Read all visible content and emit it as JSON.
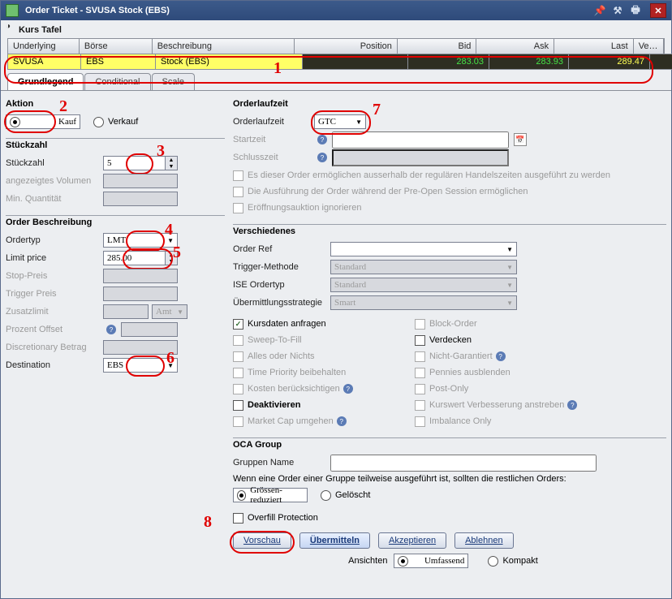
{
  "window": {
    "title": "Order Ticket - SVUSA Stock (EBS)"
  },
  "quote": {
    "panel_title": "Kurs Tafel",
    "headers": [
      "Underlying",
      "Börse",
      "Beschreibung",
      "Position",
      "Bid",
      "Ask",
      "Last",
      "Verla..."
    ],
    "row": {
      "underlying": "SVUSA",
      "exchange": "EBS",
      "description": "Stock (EBS)",
      "position": "",
      "bid": "283.03",
      "ask": "283.93",
      "last": "289.47"
    }
  },
  "tabs": [
    "Grundlegend",
    "Conditional",
    "Scale"
  ],
  "left": {
    "aktion": {
      "heading": "Aktion",
      "buy": "Kauf",
      "sell": "Verkauf"
    },
    "qty": {
      "heading": "Stückzahl",
      "label": "Stückzahl",
      "value": "5",
      "disp_vol": "angezeigtes Volumen",
      "min_qty": "Min. Quantität"
    },
    "desc": {
      "heading": "Order Beschreibung",
      "ordertyp_l": "Ordertyp",
      "ordertyp_v": "LMT",
      "limit_l": "Limit price",
      "limit_v": "285.00",
      "stop_l": "Stop-Preis",
      "trigger_l": "Trigger Preis",
      "zusatz_l": "Zusatzlimit",
      "zusatz_v": "Amt",
      "offset_l": "Prozent Offset",
      "discr_l": "Discretionary Betrag",
      "dest_l": "Destination",
      "dest_v": "EBS"
    }
  },
  "right": {
    "tif": {
      "heading": "Orderlaufzeit",
      "label": "Orderlaufzeit",
      "value": "GTC",
      "start_l": "Startzeit",
      "end_l": "Schlusszeit",
      "opt1": "Es dieser Order ermöglichen ausserhalb der regulären Handelszeiten ausgeführt zu werden",
      "opt2": "Die Ausführung der Order während der Pre-Open Session ermöglichen",
      "opt3": "Eröffnungsauktion ignorieren"
    },
    "misc": {
      "heading": "Verschiedenes",
      "ref_l": "Order Ref",
      "trig_l": "Trigger-Methode",
      "trig_v": "Standard",
      "ise_l": "ISE Ordertyp",
      "ise_v": "Standard",
      "ueb_l": "Übermittlungsstrategie",
      "ueb_v": "Smart",
      "c": {
        "kursdaten": "Kursdaten anfragen",
        "block": "Block-Order",
        "sweep": "Sweep-To-Fill",
        "verdecken": "Verdecken",
        "aon": "Alles oder Nichts",
        "ngar": "Nicht-Garantiert",
        "timeprio": "Time Priority beibehalten",
        "pennies": "Pennies ausblenden",
        "kosten": "Kosten berücksichtigen",
        "postonly": "Post-Only",
        "deakt": "Deaktivieren",
        "kurswert": "Kurswert Verbesserung anstreben",
        "marketcap": "Market Cap umgehen",
        "imbalance": "Imbalance Only"
      }
    },
    "oca": {
      "heading": "OCA Group",
      "group_l": "Gruppen Name",
      "text": "Wenn eine Order einer Gruppe teilweise ausgeführt ist, sollten die restlichen Orders:",
      "r1": "Grössen-reduziert",
      "r2": "Gelöscht",
      "overfill": "Overfill Protection"
    }
  },
  "buttons": {
    "preview": "Vorschau",
    "submit": "Übermitteln",
    "accept": "Akzeptieren",
    "reject": "Ablehnen"
  },
  "views": {
    "label": "Ansichten",
    "full": "Umfassend",
    "compact": "Kompakt"
  }
}
